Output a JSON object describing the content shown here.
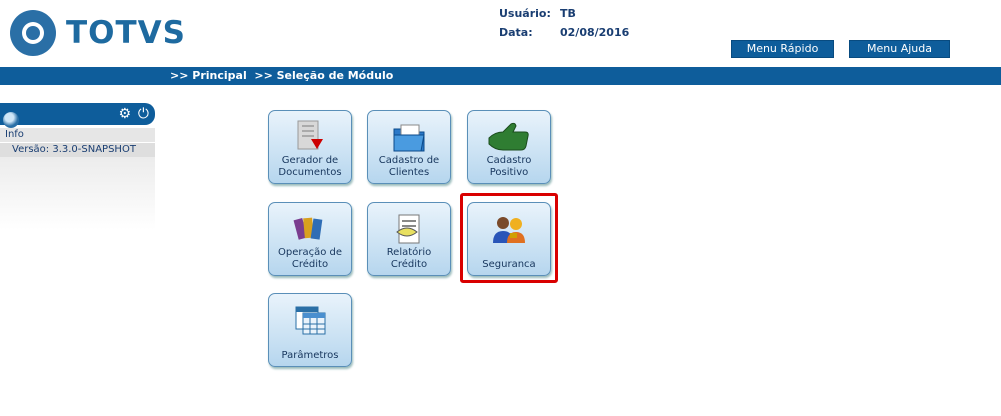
{
  "header": {
    "brand": "TOTVS",
    "user_label": "Usuário:",
    "user_value": "TB",
    "date_label": "Data:",
    "date_value": "02/08/2016",
    "menu_rapido": "Menu Rápido",
    "menu_ajuda": "Menu Ajuda"
  },
  "nav": {
    "breadcrumb": ">> Principal  >> Seleção de Módulo"
  },
  "sidebar": {
    "info_label": "Info",
    "version_label": "Versão: 3.3.0-SNAPSHOT"
  },
  "modules": [
    {
      "label": "Gerador de Documentos",
      "icon": "document-pdf-icon"
    },
    {
      "label": "Cadastro de Clientes",
      "icon": "folder-icon"
    },
    {
      "label": "Cadastro Positivo",
      "icon": "thumbs-up-icon"
    },
    {
      "label": "Operação de Crédito",
      "icon": "credit-cards-icon"
    },
    {
      "label": "Relatório Crédito",
      "icon": "report-icon"
    },
    {
      "label": "Seguranca",
      "icon": "users-security-icon"
    },
    {
      "label": "Parâmetros",
      "icon": "table-icon"
    }
  ],
  "colors": {
    "primary": "#0e5d9b",
    "highlight": "#d90000",
    "tile": "#b6d6ee"
  }
}
